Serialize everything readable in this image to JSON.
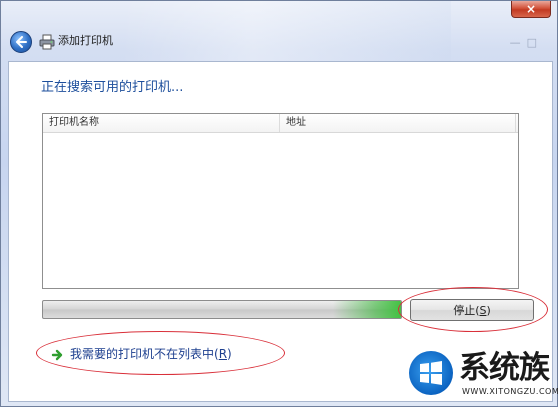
{
  "window": {
    "title": "添加打印机",
    "close_glyph": "×",
    "accent_close": "#c23a22"
  },
  "content": {
    "heading": "正在搜索可用的打印机...",
    "list": {
      "columns": [
        {
          "label": "打印机名称"
        },
        {
          "label": "地址"
        }
      ],
      "rows": []
    },
    "progress": {
      "state": "indeterminate",
      "color": "#3fc13f"
    },
    "stop_button": {
      "label_prefix": "停止(",
      "mnemonic": "S",
      "label_suffix": ")"
    },
    "link": {
      "label_prefix": "我需要的打印机不在列表中(",
      "mnemonic": "R",
      "label_suffix": ")"
    }
  },
  "watermark": {
    "name": "系统族",
    "url": "WWW.XITONGZU.COM"
  },
  "icons": {
    "back": "back-arrow-icon",
    "printer": "printer-icon",
    "link": "green-arrow-icon",
    "logo": "windows-logo-icon"
  }
}
